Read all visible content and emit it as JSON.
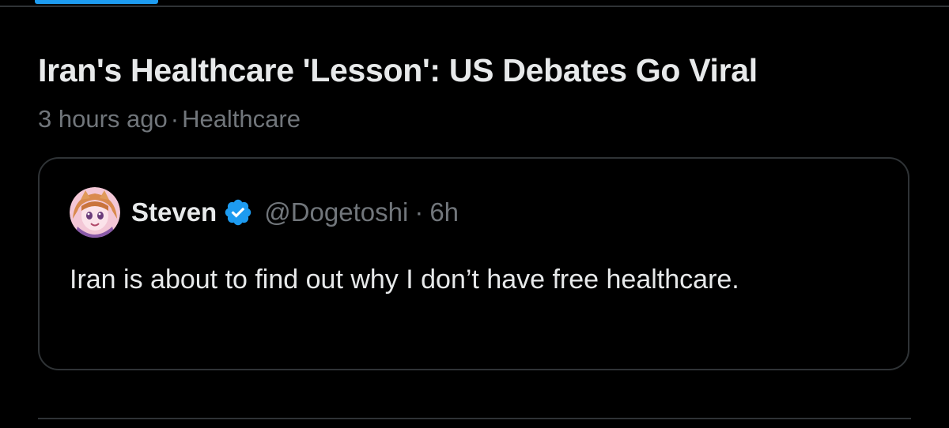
{
  "colors": {
    "background": "#000000",
    "text_primary": "#e7e9ea",
    "text_secondary": "#71767b",
    "divider": "#2f3336",
    "accent": "#1d9bf0"
  },
  "story": {
    "title": "Iran's Healthcare 'Lesson': US Debates Go Viral",
    "time_ago": "3 hours ago",
    "separator": "·",
    "category": "Healthcare"
  },
  "quote": {
    "author_name": "Steven",
    "verified_icon": "verified-badge-icon",
    "handle": "@Dogetoshi",
    "separator": "·",
    "time": "6h",
    "text": "Iran is about to find out why I don’t have free healthcare."
  }
}
